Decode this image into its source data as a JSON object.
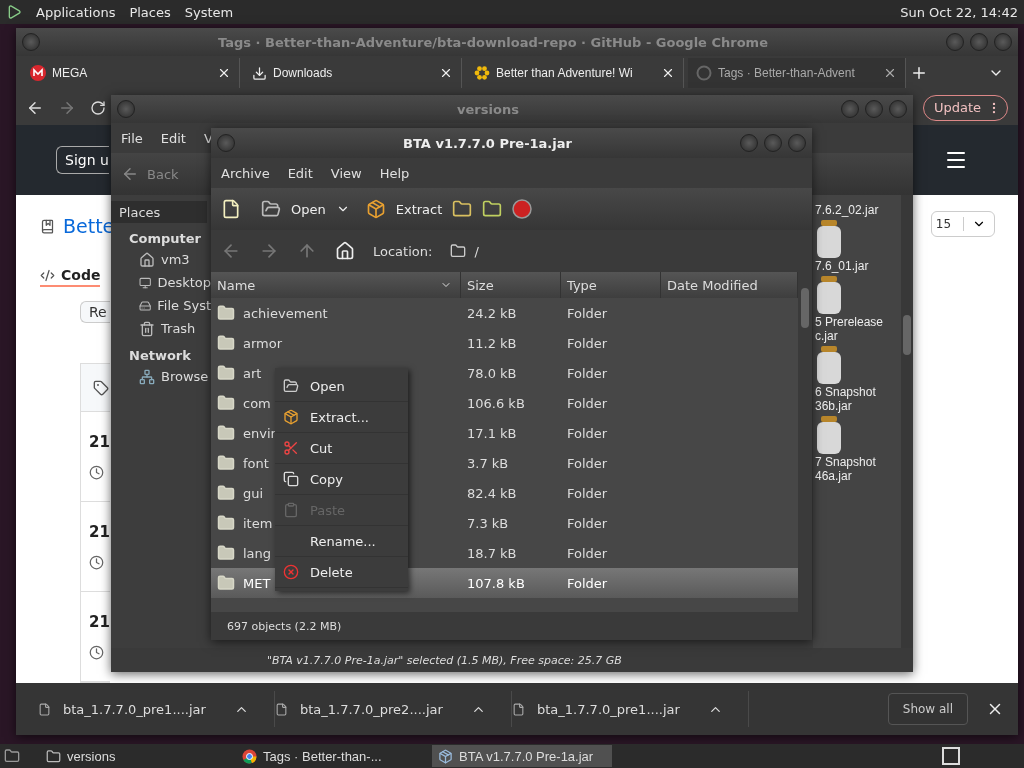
{
  "top_panel": {
    "menus": [
      "Applications",
      "Places",
      "System"
    ],
    "clock": "Sun Oct 22, 14:42"
  },
  "browser": {
    "title": "Tags · Better-than-Adventure/bta-download-repo · GitHub - Google Chrome",
    "tabs": [
      {
        "label": "MEGA",
        "selected": false,
        "kind": "mega"
      },
      {
        "label": "Downloads",
        "selected": false,
        "kind": "download"
      },
      {
        "label": "Better than Adventure! Wi",
        "selected": false,
        "kind": "flower"
      },
      {
        "label": "Tags · Better-than-Advent",
        "selected": true,
        "kind": "github"
      }
    ],
    "update_button": "Update",
    "page": {
      "sign_up": "Sign u",
      "repo_link": "Bette",
      "code_tab": "Code",
      "release_button": "Re",
      "tag_numbers": [
        "21",
        "21",
        "21"
      ],
      "count": "15"
    },
    "downloads": [
      "bta_1.7.7.0_pre1....jar",
      "bta_1.7.7.0_pre2....jar",
      "bta_1.7.7.0_pre1....jar"
    ],
    "show_all": "Show all"
  },
  "file_manager": {
    "title": "versions",
    "menus": [
      "File",
      "Edit",
      "V"
    ],
    "back": "Back",
    "places_label": "Places",
    "sidebar": [
      {
        "heading": "Computer",
        "items": [
          {
            "label": "vm3",
            "kind": "home"
          },
          {
            "label": "Desktop",
            "kind": "desktop"
          },
          {
            "label": "File Syst",
            "kind": "drive"
          },
          {
            "label": "Trash",
            "kind": "trash"
          }
        ]
      },
      {
        "heading": "Network",
        "items": [
          {
            "label": "Browse",
            "kind": "network"
          }
        ]
      }
    ],
    "icons": [
      [
        "7.6.2_02.jar"
      ],
      [
        "7.6_01.jar"
      ],
      [
        "5 Prerelease",
        "c.jar"
      ],
      [
        "6 Snapshot",
        "36b.jar"
      ],
      [
        "7 Snapshot",
        "46a.jar"
      ]
    ],
    "status": "\"BTA v1.7.7.0 Pre-1a.jar\" selected (1.5 MB), Free space: 25.7 GB"
  },
  "archive": {
    "title": "BTA v1.7.7.0 Pre-1a.jar",
    "menus": [
      "Archive",
      "Edit",
      "View",
      "Help"
    ],
    "toolbar": {
      "open": "Open",
      "extract": "Extract"
    },
    "location_label": "Location:",
    "location": "/",
    "columns": [
      "Name",
      "Size",
      "Type",
      "Date Modified"
    ],
    "rows": [
      {
        "name": "achievement",
        "size": "24.2 kB",
        "type": "Folder",
        "selected": false
      },
      {
        "name": "armor",
        "size": "11.2 kB",
        "type": "Folder",
        "selected": false
      },
      {
        "name": "art",
        "size": "78.0 kB",
        "type": "Folder",
        "selected": false
      },
      {
        "name": "com",
        "size": "106.6 kB",
        "type": "Folder",
        "selected": false
      },
      {
        "name": "envir",
        "size": "17.1 kB",
        "type": "Folder",
        "selected": false
      },
      {
        "name": "font",
        "size": "3.7 kB",
        "type": "Folder",
        "selected": false
      },
      {
        "name": "gui",
        "size": "82.4 kB",
        "type": "Folder",
        "selected": false
      },
      {
        "name": "item",
        "size": "7.3 kB",
        "type": "Folder",
        "selected": false
      },
      {
        "name": "lang",
        "size": "18.7 kB",
        "type": "Folder",
        "selected": false
      },
      {
        "name": "MET",
        "size": "107.8 kB",
        "type": "Folder",
        "selected": true
      }
    ],
    "status": "697 objects (2.2 MB)"
  },
  "context_menu": [
    {
      "label": "Open",
      "kind": "open",
      "disabled": false
    },
    {
      "label": "Extract...",
      "kind": "extract",
      "disabled": false
    },
    {
      "label": "Cut",
      "kind": "cut",
      "disabled": false
    },
    {
      "label": "Copy",
      "kind": "copy",
      "disabled": false
    },
    {
      "label": "Paste",
      "kind": "paste",
      "disabled": true
    },
    {
      "label": "Rename...",
      "kind": "none",
      "disabled": false
    },
    {
      "label": "Delete",
      "kind": "delete",
      "disabled": false
    }
  ],
  "taskbar": [
    {
      "label": "versions",
      "kind": "folder",
      "selected": false
    },
    {
      "label": "Tags · Better-than-...",
      "kind": "chrome",
      "selected": false
    },
    {
      "label": "BTA v1.7.7.0 Pre-1a.jar",
      "kind": "archive",
      "selected": true
    }
  ]
}
